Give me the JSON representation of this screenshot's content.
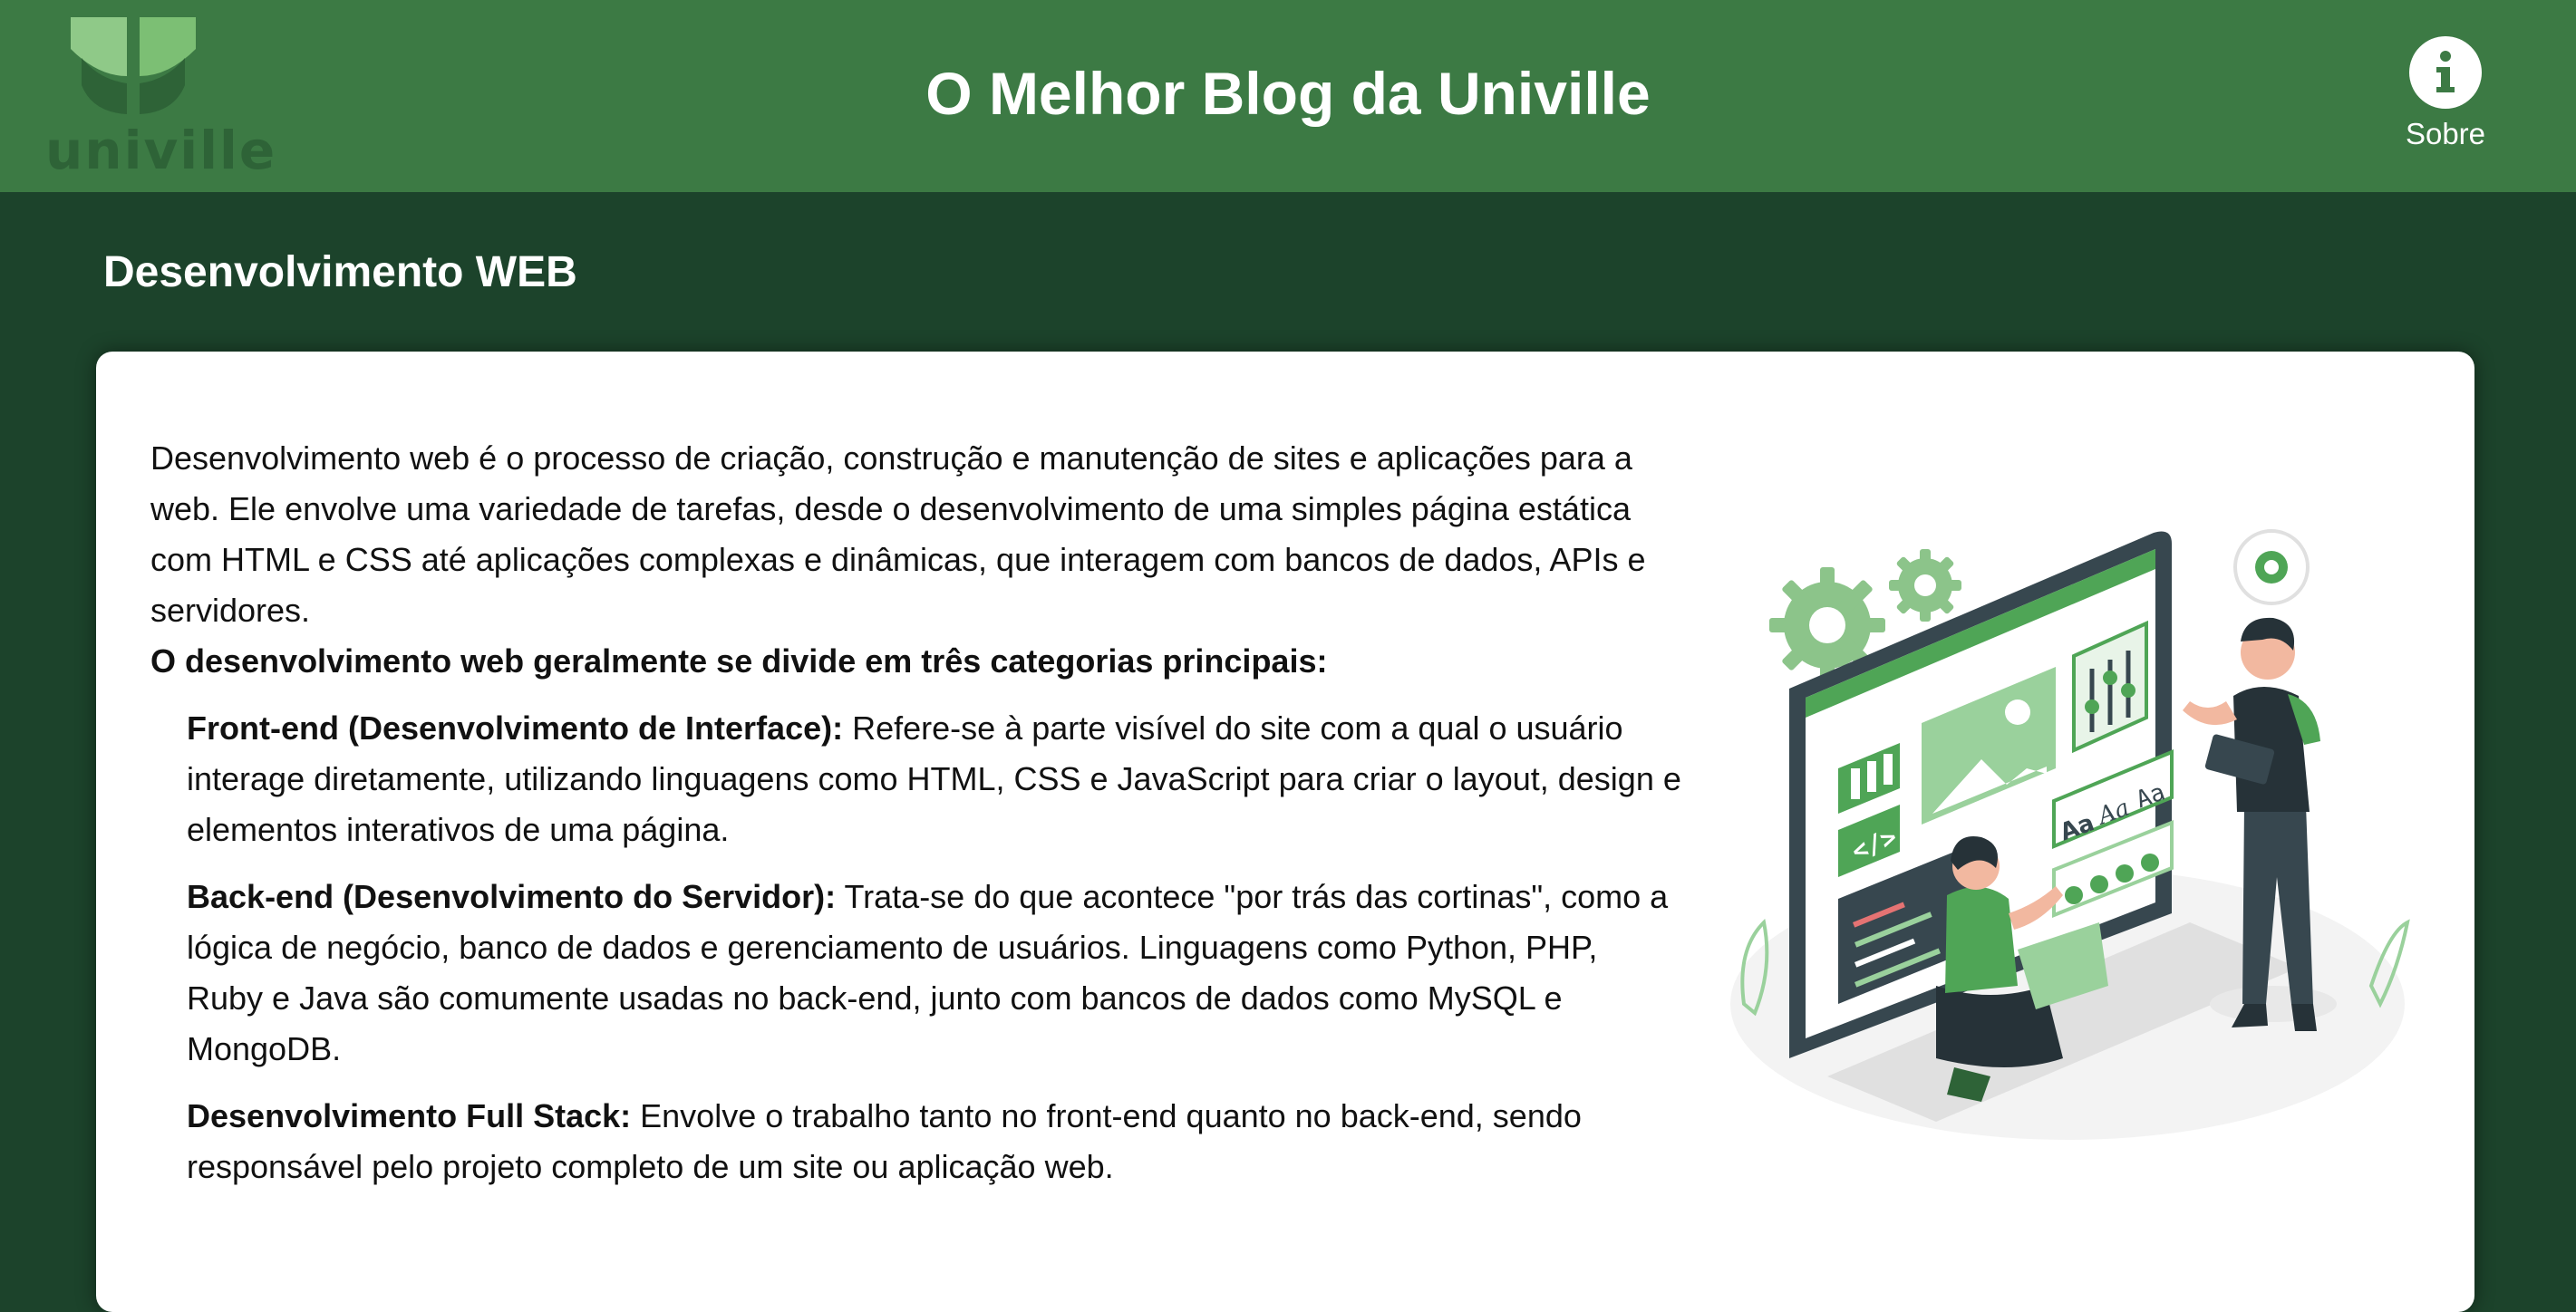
{
  "header": {
    "logo_text": "univille",
    "site_title": "O Melhor Blog da Univille",
    "about_label": "Sobre"
  },
  "section": {
    "title": "Desenvolvimento WEB"
  },
  "article": {
    "intro": "Desenvolvimento web é o processo de criação, construção e manutenção de sites e aplicações para a web. Ele envolve uma variedade de tarefas, desde o desenvolvimento de uma simples página estática com HTML e CSS até aplicações complexas e dinâmicas, que interagem com bancos de dados, APIs e servidores.",
    "lead": "O desenvolvimento web geralmente se divide em três categorias principais:",
    "categories": [
      {
        "title": "Front-end (Desenvolvimento de Interface):",
        "text": " Refere-se à parte visível do site com a qual o usuário interage diretamente, utilizando linguagens como HTML, CSS e JavaScript para criar o layout, design e elementos interativos de uma página."
      },
      {
        "title": "Back-end (Desenvolvimento do Servidor):",
        "text": " Trata-se do que acontece \"por trás das cortinas\", como a lógica de negócio, banco de dados e gerenciamento de usuários. Linguagens como Python, PHP, Ruby e Java são comumente usadas no back-end, junto com bancos de dados como MySQL e MongoDB."
      },
      {
        "title": "Desenvolvimento Full Stack:",
        "text": " Envolve o trabalho tanto no front-end quanto no back-end, sendo responsável pelo projeto completo de um site ou aplicação web."
      }
    ]
  },
  "illustration": {
    "code_symbol": "</>",
    "font_samples": [
      "Aa",
      "Aa",
      "Aa"
    ]
  },
  "colors": {
    "header_bg": "#3c7a44",
    "page_bg": "#1c432b",
    "accent_green": "#4fa556",
    "light_green": "#9ad19c"
  },
  "icons": {
    "about": "info-icon",
    "logo": "univille-leaf-logo"
  }
}
